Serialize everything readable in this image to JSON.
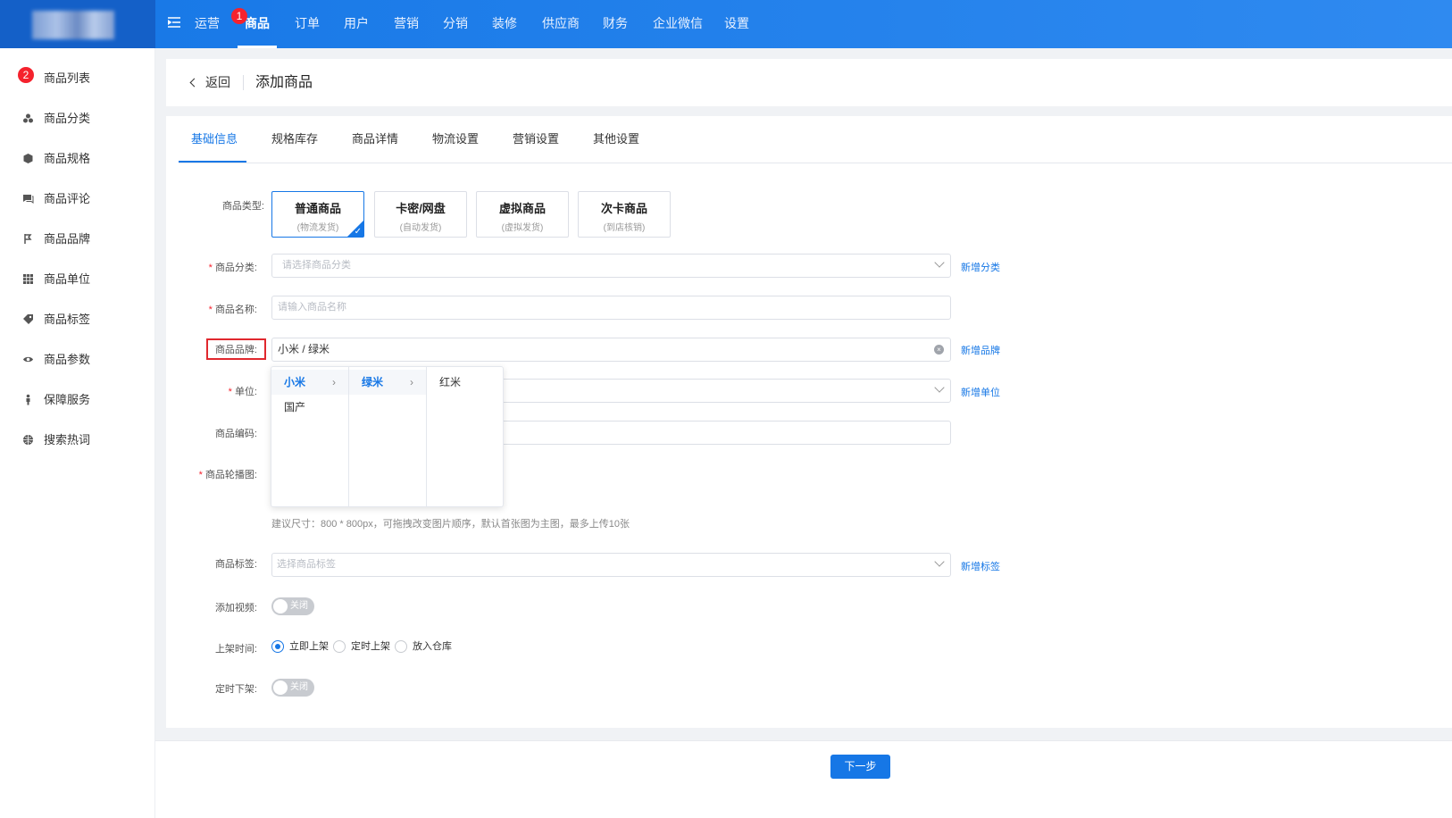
{
  "nav": {
    "items": [
      {
        "label": "运营"
      },
      {
        "label": "商品",
        "badge": "1"
      },
      {
        "label": "订单"
      },
      {
        "label": "用户"
      },
      {
        "label": "营销"
      },
      {
        "label": "分销"
      },
      {
        "label": "装修"
      },
      {
        "label": "供应商"
      },
      {
        "label": "财务"
      },
      {
        "label": "企业微信"
      },
      {
        "label": "设置"
      }
    ]
  },
  "sidebar": {
    "badge": "2",
    "items": [
      {
        "label": "商品列表",
        "icon": "list-icon"
      },
      {
        "label": "商品分类",
        "icon": "category-icon"
      },
      {
        "label": "商品规格",
        "icon": "cube-icon"
      },
      {
        "label": "商品评论",
        "icon": "comment-icon"
      },
      {
        "label": "商品品牌",
        "icon": "brand-icon"
      },
      {
        "label": "商品单位",
        "icon": "grid-icon"
      },
      {
        "label": "商品标签",
        "icon": "tag-icon"
      },
      {
        "label": "商品参数",
        "icon": "eye-icon"
      },
      {
        "label": "保障服务",
        "icon": "person-icon"
      },
      {
        "label": "搜索热词",
        "icon": "globe-icon"
      }
    ]
  },
  "header": {
    "back_label": "返回",
    "title": "添加商品"
  },
  "tabs": [
    {
      "label": "基础信息"
    },
    {
      "label": "规格库存"
    },
    {
      "label": "商品详情"
    },
    {
      "label": "物流设置"
    },
    {
      "label": "营销设置"
    },
    {
      "label": "其他设置"
    }
  ],
  "form": {
    "type_label": "商品类型:",
    "types": [
      {
        "title": "普通商品",
        "sub": "(物流发货)"
      },
      {
        "title": "卡密/网盘",
        "sub": "(自动发货)"
      },
      {
        "title": "虚拟商品",
        "sub": "(虚拟发货)"
      },
      {
        "title": "次卡商品",
        "sub": "(到店核销)"
      }
    ],
    "category": {
      "label": "商品分类:",
      "placeholder": "请选择商品分类",
      "link": "新增分类"
    },
    "name": {
      "label": "商品名称:",
      "placeholder": "请输入商品名称"
    },
    "brand": {
      "label": "商品品牌:",
      "value": "小米 / 绿米",
      "link": "新增品牌"
    },
    "unit": {
      "label": "单位:",
      "link": "新增单位"
    },
    "code": {
      "label": "商品编码:"
    },
    "carousel": {
      "label": "商品轮播图:",
      "hint": "建议尺寸：800 * 800px，可拖拽改变图片顺序，默认首张图为主图，最多上传10张"
    },
    "tags": {
      "label": "商品标签:",
      "placeholder": "选择商品标签",
      "link": "新增标签"
    },
    "video": {
      "label": "添加视频:",
      "switch_text": "关闭"
    },
    "shelf": {
      "label": "上架时间:",
      "options": [
        "立即上架",
        "定时上架",
        "放入仓库"
      ]
    },
    "offshelf": {
      "label": "定时下架:",
      "switch_text": "关闭"
    }
  },
  "cascader": {
    "col1": [
      "小米",
      "国产"
    ],
    "col2": [
      "绿米"
    ],
    "col3": [
      "红米"
    ]
  },
  "footer": {
    "next_label": "下一步"
  },
  "colors": {
    "primary": "#1677e6",
    "required": "#f5222d",
    "highlight_box": "#e0282e"
  }
}
